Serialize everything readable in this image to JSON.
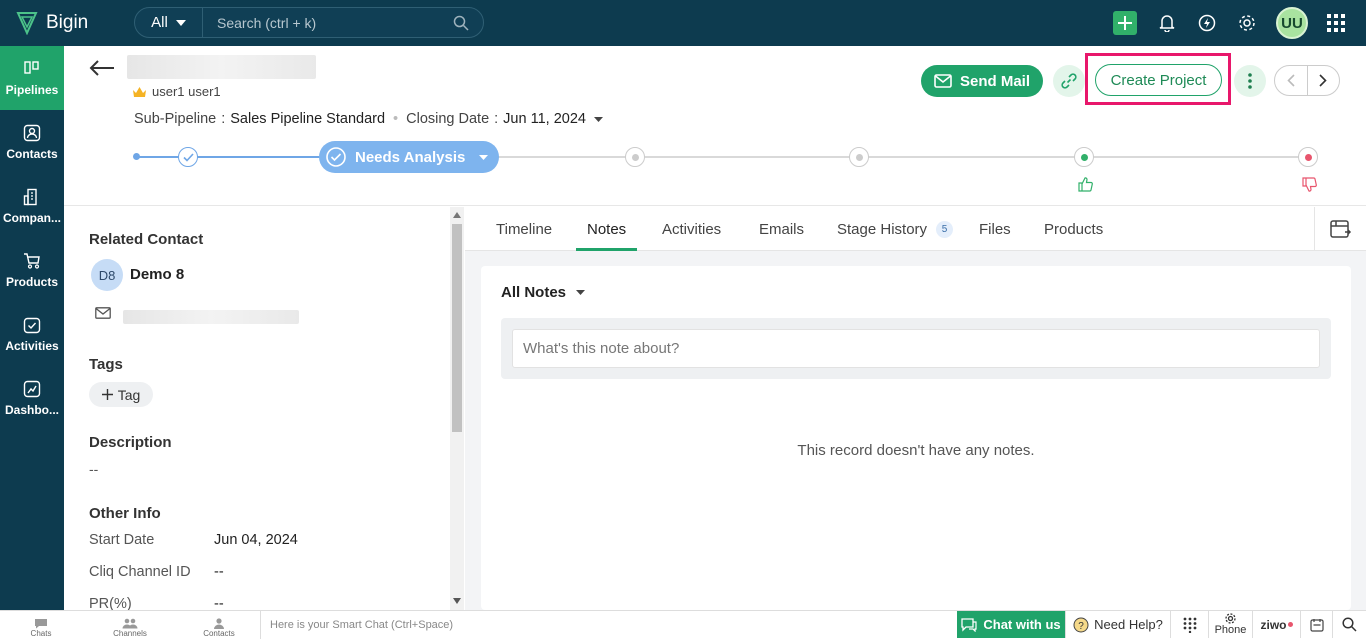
{
  "app": {
    "name": "Bigin"
  },
  "search": {
    "scope": "All",
    "placeholder": "Search (ctrl + k)"
  },
  "user": {
    "initials": "UU"
  },
  "sidebar": {
    "items": [
      {
        "label": "Pipelines",
        "icon": "pipelines-icon"
      },
      {
        "label": "Contacts",
        "icon": "contacts-icon"
      },
      {
        "label": "Compan...",
        "icon": "companies-icon"
      },
      {
        "label": "Products",
        "icon": "products-icon"
      },
      {
        "label": "Activities",
        "icon": "activities-icon"
      },
      {
        "label": "Dashbo...",
        "icon": "dashboards-icon"
      }
    ]
  },
  "record": {
    "owner": "user1 user1",
    "sub_pipeline_label": "Sub-Pipeline",
    "sub_pipeline_value": "Sales Pipeline Standard",
    "closing_label": "Closing Date",
    "closing_value": "Jun 11, 2024"
  },
  "actions": {
    "send_mail": "Send Mail",
    "create_project": "Create Project"
  },
  "stage": {
    "current": "Needs Analysis"
  },
  "left": {
    "related_contact_title": "Related Contact",
    "contact_initials": "D8",
    "contact_name": "Demo 8",
    "tags_title": "Tags",
    "tag_button": "Tag",
    "description_title": "Description",
    "description_value": "--",
    "other_info_title": "Other Info",
    "fields": [
      {
        "label": "Start Date",
        "value": "Jun 04, 2024"
      },
      {
        "label": "Cliq Channel ID",
        "value": "--"
      },
      {
        "label": "PR(%)",
        "value": "--"
      }
    ]
  },
  "tabs": {
    "items": [
      "Timeline",
      "Notes",
      "Activities",
      "Emails",
      "Stage History",
      "Files",
      "Products"
    ],
    "stage_history_count": "5"
  },
  "notes": {
    "filter": "All Notes",
    "placeholder": "What's this note about?",
    "empty": "This record doesn't have any notes."
  },
  "bottom": {
    "chats": "Chats",
    "channels": "Channels",
    "contacts": "Contacts",
    "smart_chat_placeholder": "Here is your Smart Chat (Ctrl+Space)",
    "chat_with_us": "Chat with us",
    "need_help": "Need Help?",
    "phone": "Phone",
    "ziwo": "ziwo"
  }
}
